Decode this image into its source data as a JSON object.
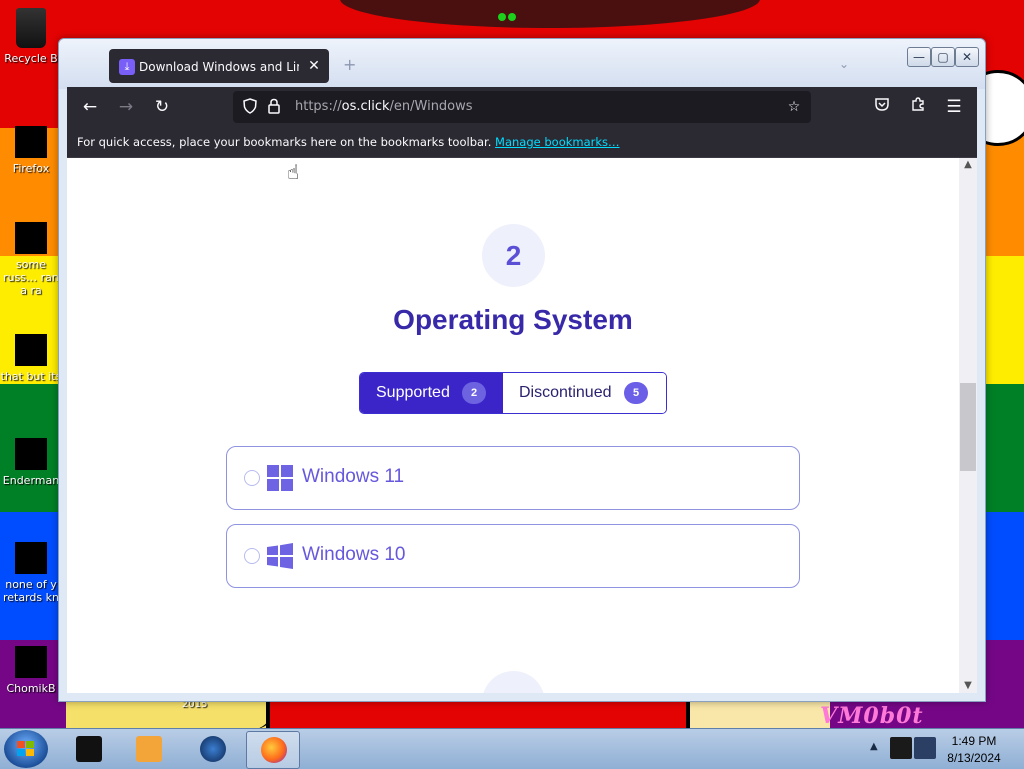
{
  "desktop": {
    "icons": [
      {
        "label": "Recycle B"
      },
      {
        "label": "Firefox"
      },
      {
        "label": "some russ… ran a ra"
      },
      {
        "label": "that but its"
      },
      {
        "label": "Enderman"
      },
      {
        "label": "none of y retards kn"
      },
      {
        "label": "ChomikB"
      }
    ],
    "year_label": "2015",
    "watermark": "VM0b0t"
  },
  "browser": {
    "tab": {
      "title": "Download Windows and Linux",
      "close_icon": "close-icon"
    },
    "new_tab_icon": "plus-icon",
    "window_controls": {
      "minimize": "—",
      "maximize": "▢",
      "close": "✕"
    },
    "nav": {
      "back": "←",
      "forward": "→",
      "reload": "↻"
    },
    "url": {
      "prefix": "https://",
      "host": "os.click",
      "path": "/en/Windows"
    },
    "bookmarks_bar": {
      "message": "For quick access, place your bookmarks here on the bookmarks toolbar.",
      "link": "Manage bookmarks…"
    }
  },
  "page": {
    "step_number": "2",
    "section_title": "Operating System",
    "toggle": {
      "supported_label": "Supported",
      "supported_count": "2",
      "discontinued_label": "Discontinued",
      "discontinued_count": "5"
    },
    "options": [
      {
        "name": "Windows 11",
        "icon": "windows-11-icon"
      },
      {
        "name": "Windows 10",
        "icon": "windows-10-icon"
      }
    ],
    "colors": {
      "accent": "#3b25c9",
      "title": "#3729a8",
      "option_text": "#6658dc"
    }
  },
  "taskbar": {
    "clock_time": "1:49 PM",
    "clock_date": "8/13/2024"
  }
}
